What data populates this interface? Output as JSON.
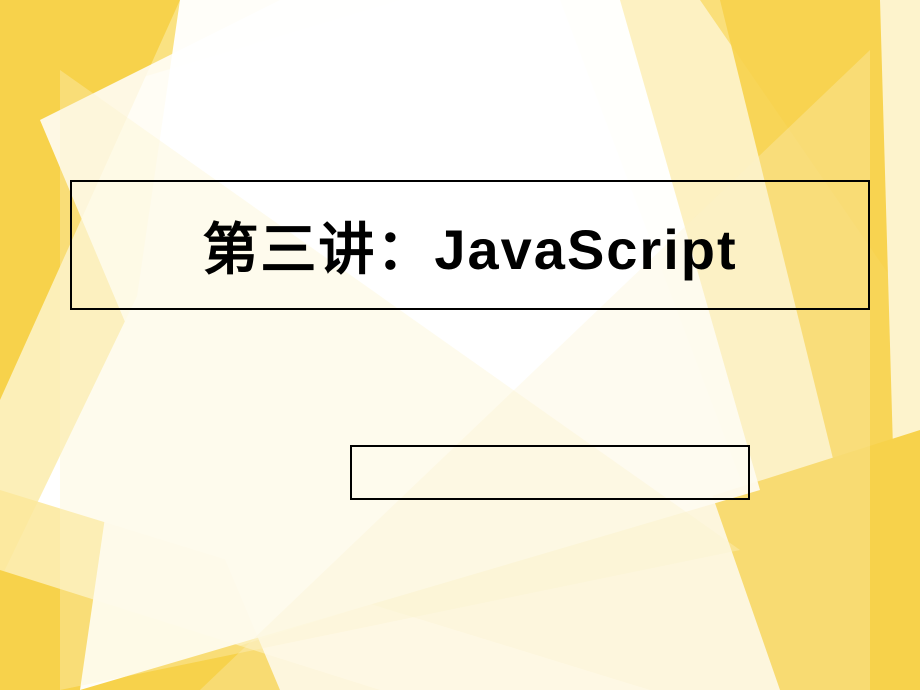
{
  "slide": {
    "title": "第三讲：JavaScript",
    "subtitle": "",
    "colors": {
      "primary": "#F7D24B",
      "light": "#FBE89A",
      "lighter": "#FDF3CC",
      "white": "#FFFFFF",
      "border": "#000000"
    }
  }
}
